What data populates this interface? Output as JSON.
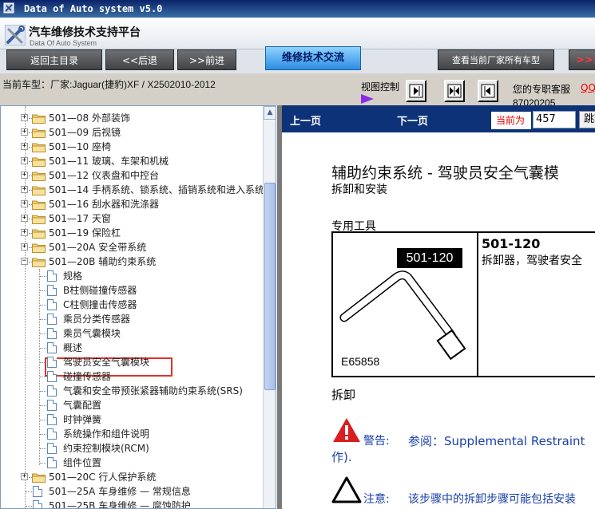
{
  "window": {
    "title": "Data of Auto system v5.0"
  },
  "header": {
    "brand": "汽车维修技术支持平台",
    "brand_sub": "Data Of Auto System"
  },
  "nav": {
    "home": "返回主目录",
    "back": "<<后退",
    "forward": ">>前进",
    "tab_active": "维修技术交流",
    "view_all": "查看当前厂家所有车型",
    "more": ">>>"
  },
  "status": {
    "vehicle": "当前车型：厂家:Jaguar(捷豹)XF / X2502010-2012",
    "view_control_label": "视图控制",
    "service_label": "您的专职客服",
    "qq_label": "QQ",
    "phone": "87020205"
  },
  "tree": {
    "items": [
      {
        "label": "501—08 外部装饰",
        "type": "folder",
        "expander": "+"
      },
      {
        "label": "501—09 后视镜",
        "type": "folder",
        "expander": "+"
      },
      {
        "label": "501—10 座椅",
        "type": "folder",
        "expander": "+"
      },
      {
        "label": "501—11 玻璃、车架和机械",
        "type": "folder",
        "expander": "+"
      },
      {
        "label": "501—12 仪表盘和中控台",
        "type": "folder",
        "expander": "+"
      },
      {
        "label": "501—14 手柄系统、锁系统、插销系统和进入系统",
        "type": "folder",
        "expander": "+"
      },
      {
        "label": "501—16 刮水器和洗涤器",
        "type": "folder",
        "expander": "+"
      },
      {
        "label": "501—17 天窗",
        "type": "folder",
        "expander": "+"
      },
      {
        "label": "501—19 保险杠",
        "type": "folder",
        "expander": "+"
      },
      {
        "label": "501—20A 安全带系统",
        "type": "folder",
        "expander": "+"
      },
      {
        "label": "501—20B 辅助约束系统",
        "type": "folder",
        "expander": "−"
      },
      {
        "label": "规格",
        "type": "doc"
      },
      {
        "label": "B柱侧碰撞传感器",
        "type": "doc"
      },
      {
        "label": "C柱侧撞击传感器",
        "type": "doc"
      },
      {
        "label": "乘员分类传感器",
        "type": "doc"
      },
      {
        "label": "乘员气囊模块",
        "type": "doc"
      },
      {
        "label": "概述",
        "type": "doc"
      },
      {
        "label": "驾驶员安全气囊模块",
        "type": "doc",
        "selected": true
      },
      {
        "label": "碰撞传感器",
        "type": "doc"
      },
      {
        "label": "气囊和安全带预张紧器辅助约束系统(SRS)",
        "type": "doc"
      },
      {
        "label": "气囊配置",
        "type": "doc"
      },
      {
        "label": "时钟弹簧",
        "type": "doc"
      },
      {
        "label": "系统操作和组件说明",
        "type": "doc"
      },
      {
        "label": "约束控制模块(RCM)",
        "type": "doc"
      },
      {
        "label": "组件位置",
        "type": "doc"
      },
      {
        "label": "501—20C 行人保护系统",
        "type": "folder",
        "expander": "+"
      },
      {
        "label": "501—25A 车身维修 — 常规信息",
        "type": "page"
      },
      {
        "label": "501—25B 车身维修 — 腐蚀防护",
        "type": "page"
      }
    ]
  },
  "doc": {
    "prev": "上一页",
    "next": "下一页",
    "current_label": "当前为",
    "page_value": "457",
    "jump_label": "跳转",
    "title": "辅助约束系统 - 驾驶员安全气囊模",
    "subtitle": "拆卸和安装",
    "special_tools_heading": "专用工具",
    "tool_image_tag": "501-120",
    "tool_image_number": "E65858",
    "tool_id": "501-120",
    "tool_name": "拆卸器，驾驶者安全",
    "removal_heading": "拆卸",
    "warning_label": "警告:",
    "warning_text": "参阅：Supplemental Restraint",
    "warning_text_cont": "作).",
    "note_label": "注意:",
    "note_text": "该步骤中的拆卸步骤可能包括安装"
  },
  "colors": {
    "doc_bar": "#0d3278",
    "highlight": "#e0322b",
    "warning_text": "#1a3fa8"
  }
}
